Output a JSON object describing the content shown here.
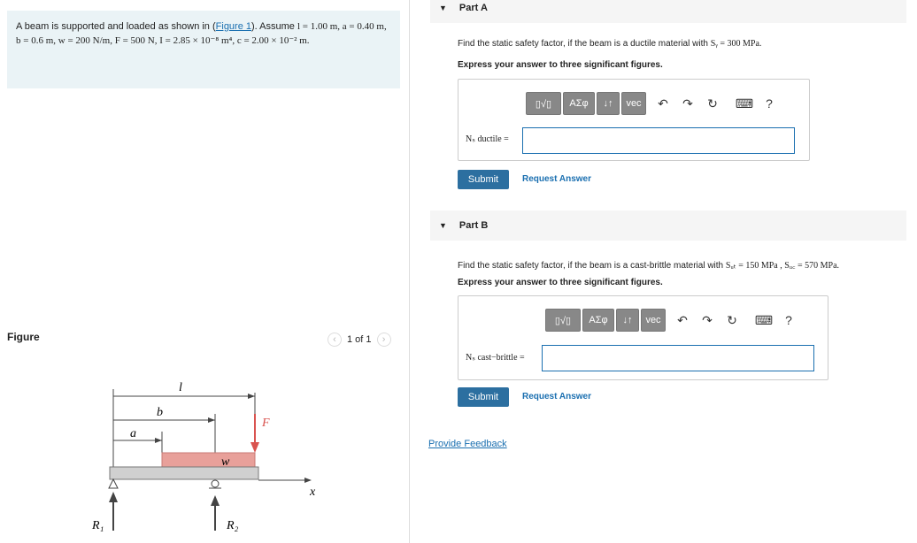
{
  "problem": {
    "intro": "A beam is supported and loaded as shown in (",
    "figure_link": "Figure 1",
    "after_link": "). Assume ",
    "line1_vars": "l = 1.00 m, a = 0.40 m,",
    "line2": "b = 0.6 m, w = 200 N/m, F = 500 N, I = 2.85 × 10⁻⁸ m⁴, c = 2.00 × 10⁻² m."
  },
  "figure": {
    "heading": "Figure",
    "pager_text": "1 of 1",
    "prev": "‹",
    "next": "›",
    "labels": {
      "l": "l",
      "b": "b",
      "a": "a",
      "F": "F",
      "w": "w",
      "x": "x",
      "R1": "R₁",
      "R2": "R₂"
    }
  },
  "partA": {
    "title": "Part A",
    "question_pre": "Find the static safety factor, if the beam is a ductile material with ",
    "question_math": "Sᵧ = 300 MPa.",
    "instruction": "Express your answer to three significant figures.",
    "answer_label": "Nₛ ductile =",
    "answer_value": "",
    "submit": "Submit",
    "request": "Request Answer"
  },
  "partB": {
    "title": "Part B",
    "question_pre": "Find the static safety factor, if the beam is a cast-brittle material with ",
    "question_math": "Sᵤₜ = 150 MPa , Sᵤ꜀ = 570 MPa.",
    "instruction": "Express your answer to three significant figures.",
    "answer_label": "Nₛ cast−brittle =",
    "answer_value": "",
    "submit": "Submit",
    "request": "Request Answer"
  },
  "toolbar": {
    "templates": "▯√▯",
    "greek": "ΑΣφ",
    "arrows": "↓↑",
    "vec": "vec",
    "undo": "↶",
    "redo": "↷",
    "reset": "↻",
    "keyboard": "⌨",
    "help": "?"
  },
  "feedback": "Provide Feedback"
}
